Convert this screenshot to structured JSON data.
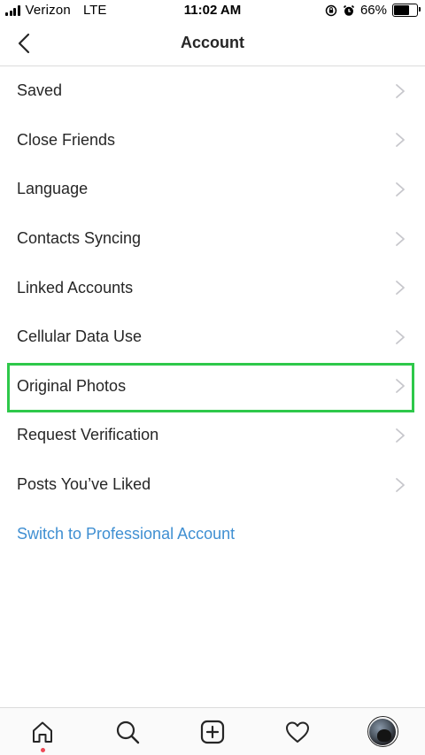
{
  "status_bar": {
    "carrier": "Verizon",
    "network": "LTE",
    "time": "11:02 AM",
    "battery_percent_text": "66%",
    "battery_level": 0.66
  },
  "header": {
    "title": "Account"
  },
  "menu": {
    "items": [
      {
        "label": "Saved"
      },
      {
        "label": "Close Friends"
      },
      {
        "label": "Language"
      },
      {
        "label": "Contacts Syncing"
      },
      {
        "label": "Linked Accounts"
      },
      {
        "label": "Cellular Data Use"
      },
      {
        "label": "Original Photos"
      },
      {
        "label": "Request Verification"
      },
      {
        "label": "Posts You’ve Liked"
      }
    ],
    "highlighted_item": "Original Photos",
    "link_label": "Switch to Professional Account"
  },
  "tab_bar": {
    "tabs": [
      "home-icon",
      "search-icon",
      "add-post-icon",
      "activity-heart-icon",
      "profile-avatar"
    ],
    "notification_dot_color": "#ed4956"
  },
  "colors": {
    "highlight_border": "#2ec84a",
    "link": "#3f8fd2",
    "text": "#262626",
    "chevron": "#c7c7cc"
  }
}
